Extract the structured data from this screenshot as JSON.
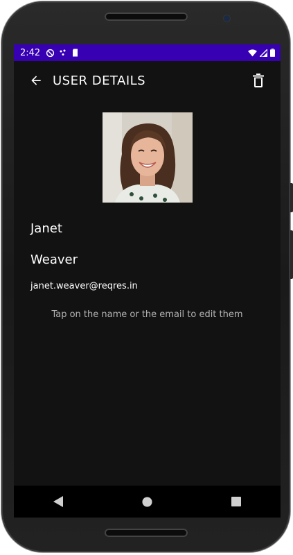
{
  "status_bar": {
    "time": "2:42",
    "left_icons": [
      "do-not-disturb-icon",
      "dots-icon",
      "sd-card-icon"
    ],
    "right_icons": [
      "wifi-icon",
      "signal-icon",
      "battery-icon"
    ],
    "background": "#3700b3"
  },
  "app_bar": {
    "title": "USER DETAILS",
    "back_icon": "arrow-left-icon",
    "delete_icon": "trash-icon"
  },
  "user": {
    "first_name": "Janet",
    "last_name": "Weaver",
    "email": "janet.weaver@reqres.in"
  },
  "hint": "Tap on the name or the email to edit them",
  "nav_bar": {
    "buttons": [
      "back-triangle-icon",
      "home-circle-icon",
      "recents-square-icon"
    ]
  },
  "colors": {
    "screen_bg": "#121212",
    "status_bar": "#3700b3",
    "text_primary": "#ffffff",
    "text_secondary": "#b3b3b3"
  }
}
